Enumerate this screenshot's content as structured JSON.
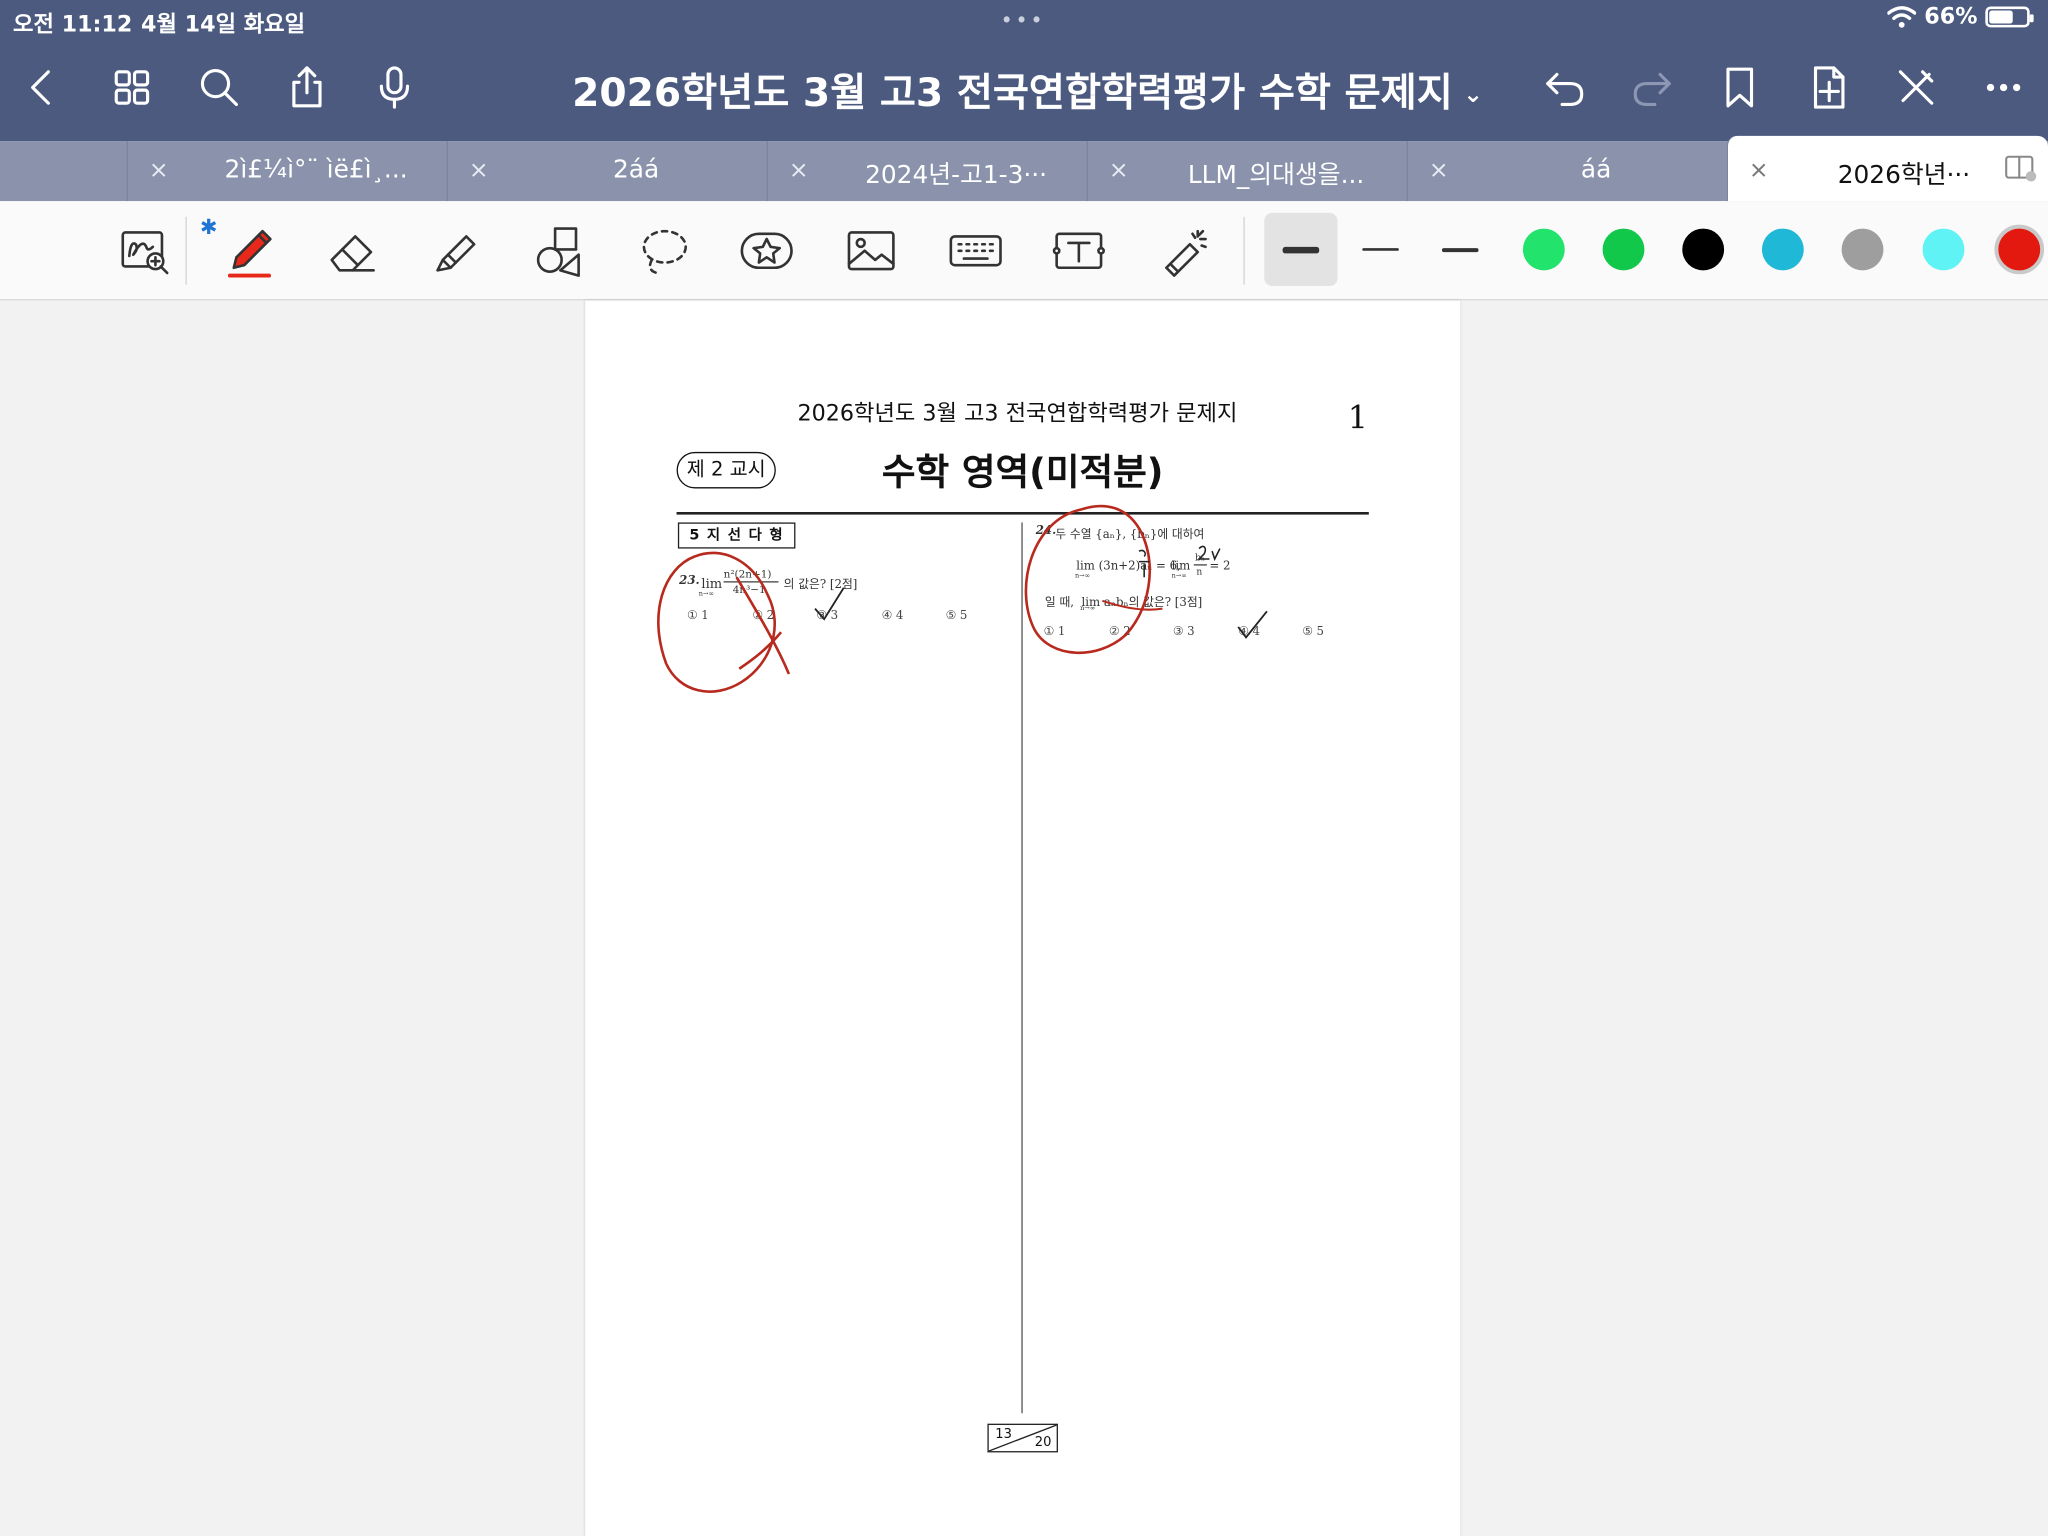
{
  "status_bar": {
    "time": "오전 11:12",
    "date": "4월 14일 화요일",
    "dots": "•••",
    "battery_percent": "66%",
    "battery_level": 0.66
  },
  "title_bar": {
    "document_title": "2026학년도 3월 고3 전국연합학력평가 수학 문제지",
    "title_chevron": "⌄",
    "icons": [
      "back-icon",
      "grid-icon",
      "search-icon",
      "share-icon",
      "microphone-icon",
      "undo-icon",
      "redo-icon",
      "bookmark-icon",
      "add-page-icon",
      "pen-off-icon",
      "more-icon"
    ]
  },
  "tabs": [
    {
      "label": "2ì£¼ì°¨ ìë£ì¸...",
      "close": "×"
    },
    {
      "label": "2áá",
      "close": "×"
    },
    {
      "label": "2024년-고1-3···",
      "close": "×"
    },
    {
      "label": "LLM_의대생을...",
      "close": "×"
    },
    {
      "label": "áá",
      "close": "×"
    },
    {
      "label": "2026학년···",
      "close": "×",
      "active": true
    }
  ],
  "toolbar": {
    "tools": [
      "zoom-handwriting-icon",
      "pen-icon",
      "eraser-icon",
      "highlighter-icon",
      "shapes-icon",
      "lasso-icon",
      "sticker-icon",
      "image-icon",
      "keyboard-icon",
      "text-box-icon",
      "laser-pointer-icon"
    ],
    "bluetooth": "✱",
    "colors": [
      "#22e36b",
      "#12c84a",
      "#000000",
      "#1fb8d6",
      "#9e9e9e",
      "#5ff3f6",
      "#e3190f"
    ],
    "selected_color": "#e3190f"
  },
  "document": {
    "header": "2026학년도 3월 고3 전국연합학력평가 문제지",
    "page_number": "1",
    "period": "제 2 교시",
    "subject": "수학 영역(미적분)",
    "question_type": "5 지 선 다 형",
    "q23": {
      "number": "23.",
      "prefix": "lim",
      "limit_sub": "n→∞",
      "numerator": "n²(2n+1)",
      "denominator": "4n³−1",
      "suffix": "의 값은? [2점]",
      "choices": [
        "① 1",
        "② 2",
        "③ 3",
        "④ 4",
        "⑤ 5"
      ]
    },
    "q24": {
      "number": "24.",
      "line1": "두 수열 {aₙ}, {bₙ}에 대하여",
      "expr_a": "lim (3n+2)aₙ = 6,",
      "expr_b": "lim",
      "expr_b_frac_num": "bₙ",
      "expr_b_frac_den": "n",
      "expr_b_tail": "= 2",
      "limit_sub": "n→∞",
      "line3_pre": "일 때,",
      "line3_expr": "lim aₙbₙ의 값은? [3점]",
      "choices": [
        "① 1",
        "② 2",
        "③ 3",
        "④ 4",
        "⑤ 5"
      ]
    },
    "page_counter": {
      "current": "13",
      "total": "20"
    }
  }
}
